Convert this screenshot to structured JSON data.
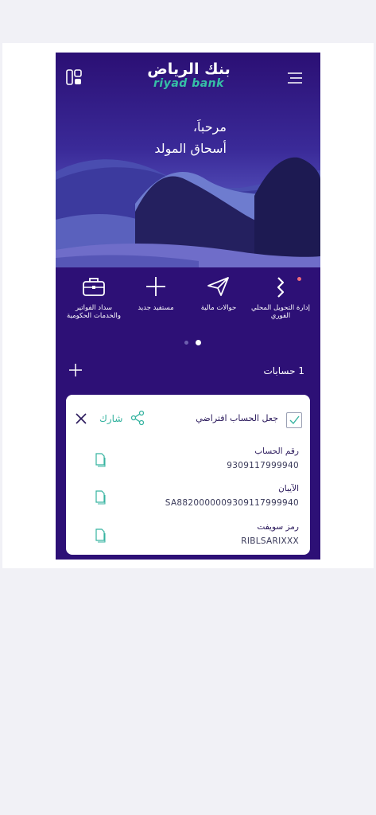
{
  "header": {
    "logo_ar": "بنك الرياض",
    "logo_en": "riyad bank",
    "menu_icon": "hamburger-menu-icon",
    "widgets_icon": "widgets-icon"
  },
  "greeting": {
    "line1": "مرحباَ،",
    "line2": "أسحاق المولد"
  },
  "quick_actions": [
    {
      "label": "إدارة التحويل المحلي الفوري",
      "icon": "instant-transfer-icon"
    },
    {
      "label": "حوالات مالية",
      "icon": "paper-plane-icon"
    },
    {
      "label": "مستفيد جديد",
      "icon": "plus-icon"
    },
    {
      "label": "سداد الفواتير والخدمات الحكومية",
      "icon": "briefcase-icon"
    }
  ],
  "accounts": {
    "count_label": "1 حسابات"
  },
  "account_card": {
    "default_label": "جعل الحساب افتراضي",
    "share_label": "شارك",
    "fields": [
      {
        "key": "رقم الحساب",
        "value": "9309117999940"
      },
      {
        "key": "الآيبان",
        "value": "SA8820000009309117999940"
      },
      {
        "key": "رمز سويفت",
        "value": "RIBLSARIXXX"
      }
    ]
  },
  "colors": {
    "brand_purple": "#2d1076",
    "brand_green": "#36c1a6",
    "accent_red": "#f06b7a"
  }
}
